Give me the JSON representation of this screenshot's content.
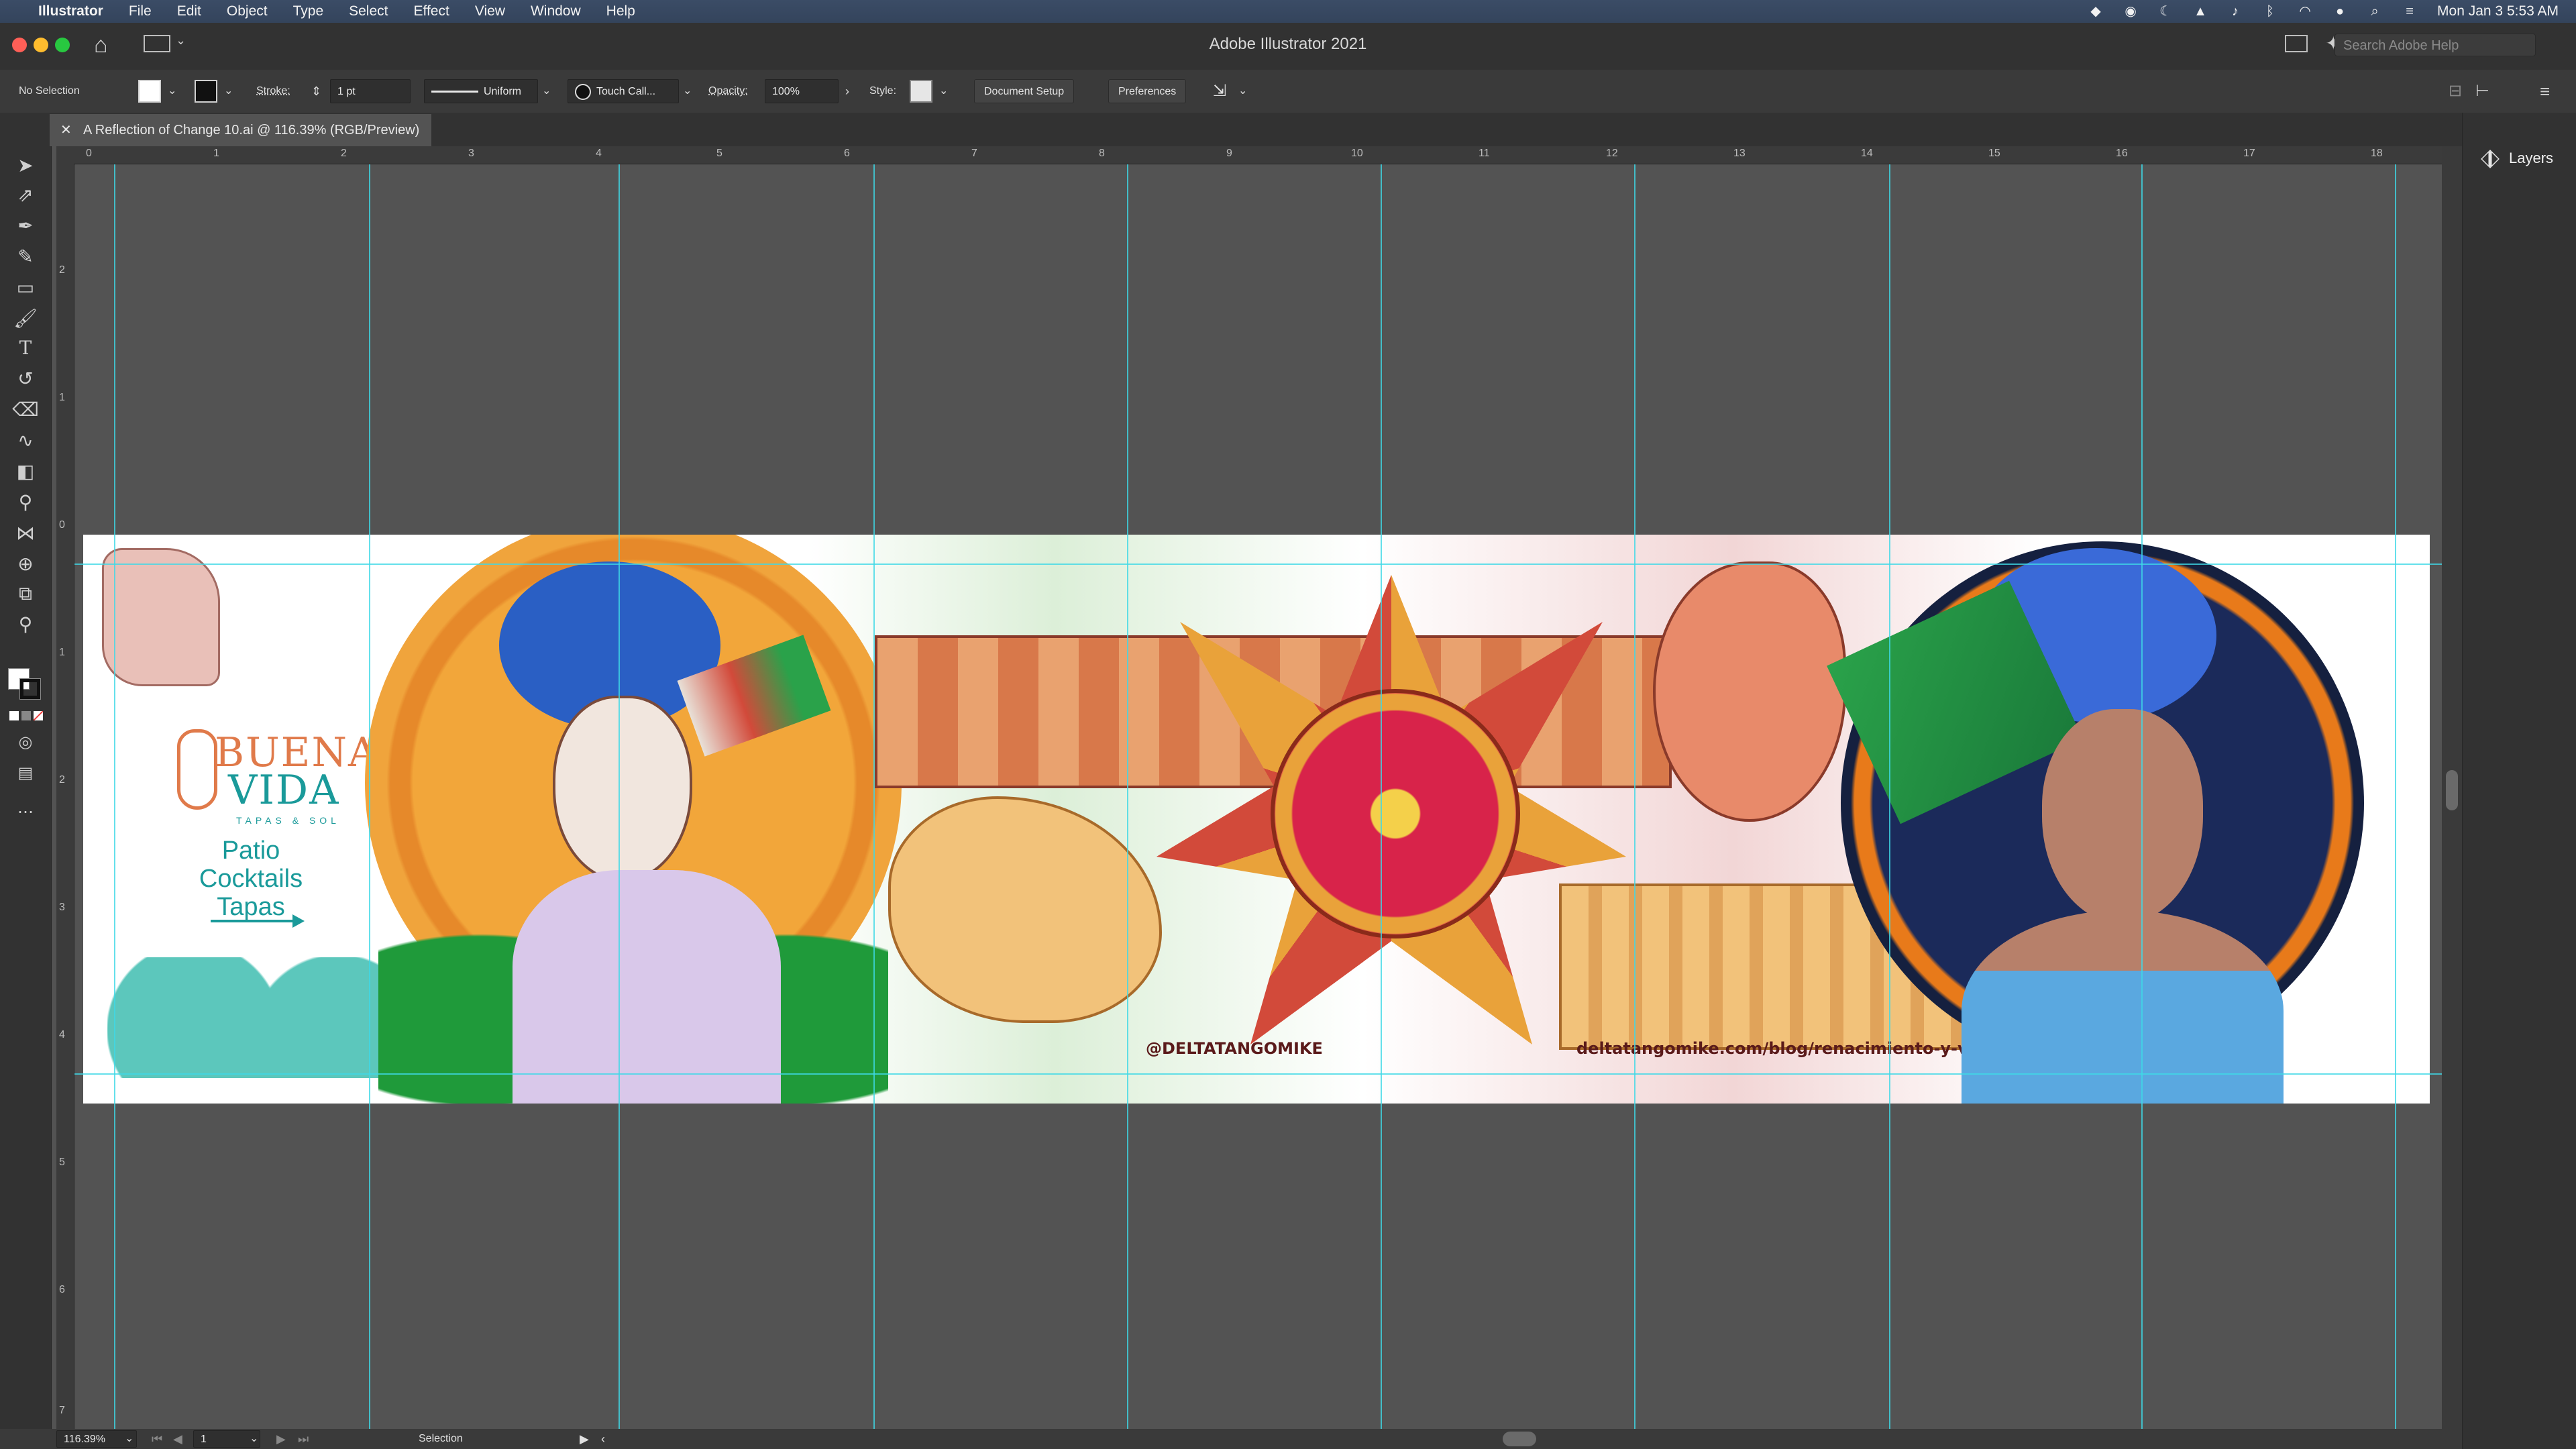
{
  "menubar": {
    "app_name": "Illustrator",
    "items": [
      "File",
      "Edit",
      "Object",
      "Type",
      "Select",
      "Effect",
      "View",
      "Window",
      "Help"
    ],
    "clock": "Mon Jan 3  5:53 AM"
  },
  "window": {
    "title": "Adobe Illustrator 2021",
    "search_placeholder": "Search Adobe Help"
  },
  "control_bar": {
    "selection_state": "No Selection",
    "stroke_label": "Stroke:",
    "stroke_weight": "1 pt",
    "profile": "Uniform",
    "brush": "Touch Call...",
    "opacity_label": "Opacity:",
    "opacity_value": "100%",
    "style_label": "Style:",
    "document_setup": "Document Setup",
    "preferences": "Preferences"
  },
  "document": {
    "tab_title": "A Reflection of Change 10.ai @ 116.39% (RGB/Preview)"
  },
  "rulers": {
    "top": [
      "0",
      "1",
      "2",
      "3",
      "4",
      "5",
      "6",
      "7",
      "8",
      "9",
      "10",
      "11",
      "12",
      "13",
      "14",
      "15",
      "16",
      "17",
      "18"
    ],
    "left": [
      "2",
      "1",
      "0",
      "1",
      "2",
      "3",
      "4",
      "5",
      "6",
      "7"
    ]
  },
  "panels": {
    "layers_label": "Layers"
  },
  "statusbar": {
    "zoom": "116.39%",
    "artboard_number": "1",
    "tool_name": "Selection"
  },
  "artwork": {
    "brand_line1": "BUENA",
    "brand_line2": "VIDA",
    "brand_tagline": "TAPAS & SOL",
    "menu_line1": "Patio",
    "menu_line2": "Cocktails",
    "menu_line3": "Tapas",
    "handle": "@DELTATANGOMIKE",
    "url": "deltatangomike.com/blog/renacimiento-y-vida"
  },
  "colors": {
    "guide": "#3fd8e6",
    "ui_dark": "#323232",
    "canvas": "#535353",
    "teal": "#1a9a9a",
    "orange": "#e07a4a"
  }
}
